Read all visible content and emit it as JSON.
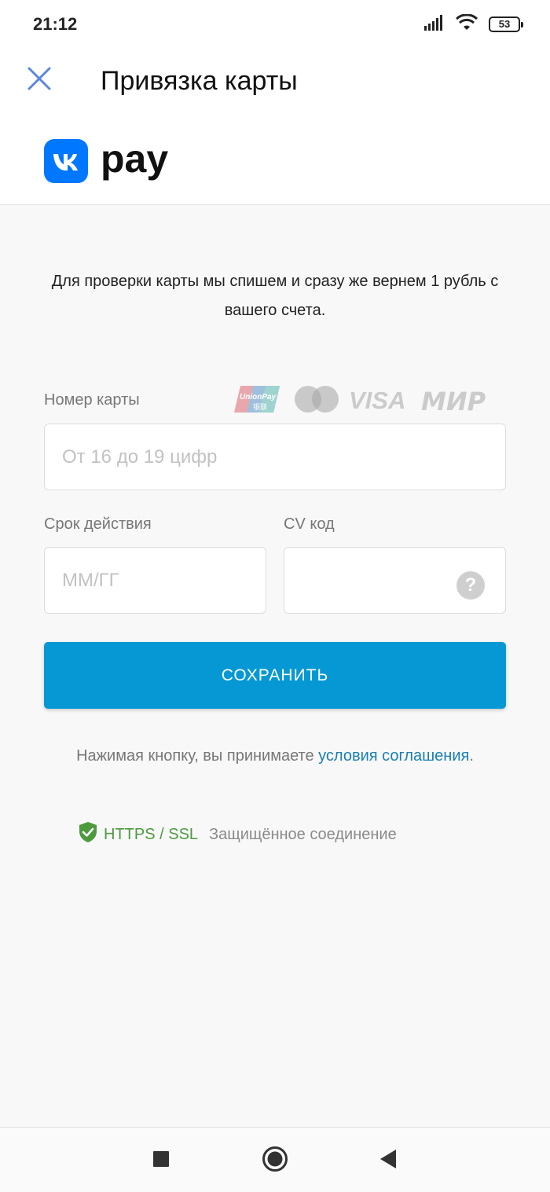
{
  "status_bar": {
    "time": "21:12",
    "battery": "53",
    "icons": [
      "signal-icon",
      "wifi-icon",
      "battery-icon"
    ]
  },
  "app_bar": {
    "close_icon": "close-icon",
    "title": "Привязка карты"
  },
  "brand": {
    "logo_text": "VK",
    "name": "pay",
    "accent": "#0077ff"
  },
  "info": {
    "text": "Для проверки карты мы спишем и сразу же вернем 1 рубль с вашего счета."
  },
  "form": {
    "card_number": {
      "label": "Номер карты",
      "placeholder": "От 16 до 19 цифр",
      "value": ""
    },
    "card_logos": [
      "UnionPay",
      "Mastercard",
      "VISA",
      "МИР"
    ],
    "unionpay_text": "UnionPay",
    "unionpay_cn": "银联",
    "expiry": {
      "label": "Срок действия",
      "placeholder": "ММ/ГГ",
      "value": ""
    },
    "cvv": {
      "label": "CV код",
      "placeholder": "",
      "value": "",
      "help": "?"
    },
    "save_label": "СОХРАНИТЬ",
    "button_color": "#0698d4"
  },
  "terms": {
    "prefix": "Нажимая кнопку, вы принимаете ",
    "link": "условия соглашения",
    "suffix": "."
  },
  "secure": {
    "protocol": "HTTPS / SSL",
    "text": "Защищённое соединение",
    "color": "#4d9a3e"
  },
  "nav": {
    "icons": [
      "recents-icon",
      "home-icon",
      "back-icon"
    ]
  }
}
